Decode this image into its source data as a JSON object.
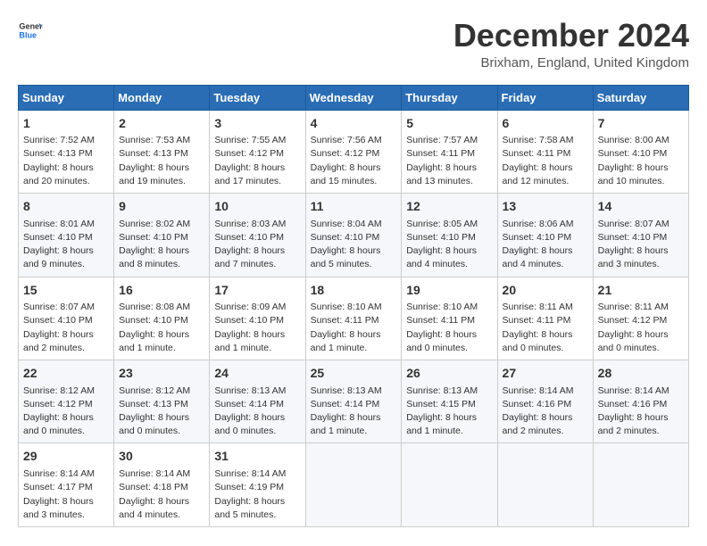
{
  "logo": {
    "line1": "General",
    "line2": "Blue"
  },
  "title": "December 2024",
  "location": "Brixham, England, United Kingdom",
  "days_of_week": [
    "Sunday",
    "Monday",
    "Tuesday",
    "Wednesday",
    "Thursday",
    "Friday",
    "Saturday"
  ],
  "weeks": [
    [
      {
        "day": "1",
        "sunrise": "7:52 AM",
        "sunset": "4:13 PM",
        "daylight": "8 hours and 20 minutes."
      },
      {
        "day": "2",
        "sunrise": "7:53 AM",
        "sunset": "4:13 PM",
        "daylight": "8 hours and 19 minutes."
      },
      {
        "day": "3",
        "sunrise": "7:55 AM",
        "sunset": "4:12 PM",
        "daylight": "8 hours and 17 minutes."
      },
      {
        "day": "4",
        "sunrise": "7:56 AM",
        "sunset": "4:12 PM",
        "daylight": "8 hours and 15 minutes."
      },
      {
        "day": "5",
        "sunrise": "7:57 AM",
        "sunset": "4:11 PM",
        "daylight": "8 hours and 13 minutes."
      },
      {
        "day": "6",
        "sunrise": "7:58 AM",
        "sunset": "4:11 PM",
        "daylight": "8 hours and 12 minutes."
      },
      {
        "day": "7",
        "sunrise": "8:00 AM",
        "sunset": "4:10 PM",
        "daylight": "8 hours and 10 minutes."
      }
    ],
    [
      {
        "day": "8",
        "sunrise": "8:01 AM",
        "sunset": "4:10 PM",
        "daylight": "8 hours and 9 minutes."
      },
      {
        "day": "9",
        "sunrise": "8:02 AM",
        "sunset": "4:10 PM",
        "daylight": "8 hours and 8 minutes."
      },
      {
        "day": "10",
        "sunrise": "8:03 AM",
        "sunset": "4:10 PM",
        "daylight": "8 hours and 7 minutes."
      },
      {
        "day": "11",
        "sunrise": "8:04 AM",
        "sunset": "4:10 PM",
        "daylight": "8 hours and 5 minutes."
      },
      {
        "day": "12",
        "sunrise": "8:05 AM",
        "sunset": "4:10 PM",
        "daylight": "8 hours and 4 minutes."
      },
      {
        "day": "13",
        "sunrise": "8:06 AM",
        "sunset": "4:10 PM",
        "daylight": "8 hours and 4 minutes."
      },
      {
        "day": "14",
        "sunrise": "8:07 AM",
        "sunset": "4:10 PM",
        "daylight": "8 hours and 3 minutes."
      }
    ],
    [
      {
        "day": "15",
        "sunrise": "8:07 AM",
        "sunset": "4:10 PM",
        "daylight": "8 hours and 2 minutes."
      },
      {
        "day": "16",
        "sunrise": "8:08 AM",
        "sunset": "4:10 PM",
        "daylight": "8 hours and 1 minute."
      },
      {
        "day": "17",
        "sunrise": "8:09 AM",
        "sunset": "4:10 PM",
        "daylight": "8 hours and 1 minute."
      },
      {
        "day": "18",
        "sunrise": "8:10 AM",
        "sunset": "4:11 PM",
        "daylight": "8 hours and 1 minute."
      },
      {
        "day": "19",
        "sunrise": "8:10 AM",
        "sunset": "4:11 PM",
        "daylight": "8 hours and 0 minutes."
      },
      {
        "day": "20",
        "sunrise": "8:11 AM",
        "sunset": "4:11 PM",
        "daylight": "8 hours and 0 minutes."
      },
      {
        "day": "21",
        "sunrise": "8:11 AM",
        "sunset": "4:12 PM",
        "daylight": "8 hours and 0 minutes."
      }
    ],
    [
      {
        "day": "22",
        "sunrise": "8:12 AM",
        "sunset": "4:12 PM",
        "daylight": "8 hours and 0 minutes."
      },
      {
        "day": "23",
        "sunrise": "8:12 AM",
        "sunset": "4:13 PM",
        "daylight": "8 hours and 0 minutes."
      },
      {
        "day": "24",
        "sunrise": "8:13 AM",
        "sunset": "4:14 PM",
        "daylight": "8 hours and 0 minutes."
      },
      {
        "day": "25",
        "sunrise": "8:13 AM",
        "sunset": "4:14 PM",
        "daylight": "8 hours and 1 minute."
      },
      {
        "day": "26",
        "sunrise": "8:13 AM",
        "sunset": "4:15 PM",
        "daylight": "8 hours and 1 minute."
      },
      {
        "day": "27",
        "sunrise": "8:14 AM",
        "sunset": "4:16 PM",
        "daylight": "8 hours and 2 minutes."
      },
      {
        "day": "28",
        "sunrise": "8:14 AM",
        "sunset": "4:16 PM",
        "daylight": "8 hours and 2 minutes."
      }
    ],
    [
      {
        "day": "29",
        "sunrise": "8:14 AM",
        "sunset": "4:17 PM",
        "daylight": "8 hours and 3 minutes."
      },
      {
        "day": "30",
        "sunrise": "8:14 AM",
        "sunset": "4:18 PM",
        "daylight": "8 hours and 4 minutes."
      },
      {
        "day": "31",
        "sunrise": "8:14 AM",
        "sunset": "4:19 PM",
        "daylight": "8 hours and 5 minutes."
      },
      null,
      null,
      null,
      null
    ]
  ],
  "labels": {
    "sunrise": "Sunrise:",
    "sunset": "Sunset:",
    "daylight": "Daylight:"
  }
}
